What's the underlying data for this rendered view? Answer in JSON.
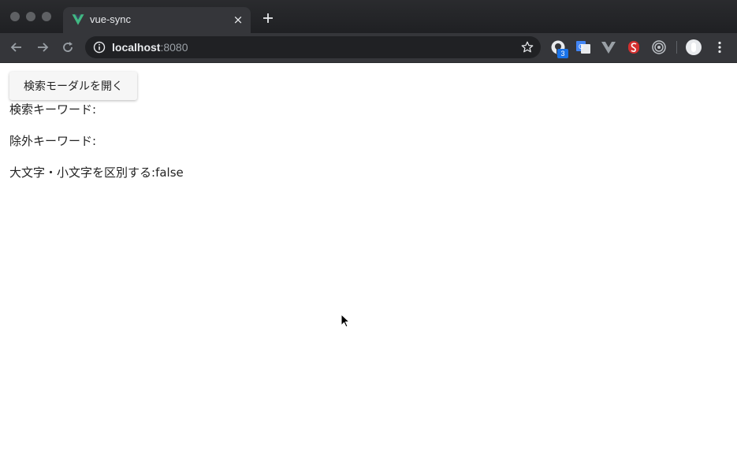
{
  "browser": {
    "tab_title": "vue-sync",
    "tab_close": "×",
    "url_host": "localhost",
    "url_port": ":8080",
    "extension_badge": "3",
    "accent_color": "#41b883"
  },
  "page": {
    "open_modal_button": "検索モーダルを開く",
    "search_keyword_label": "検索キーワード:",
    "search_keyword_value": "",
    "exclude_keyword_label": "除外キーワード:",
    "exclude_keyword_value": "",
    "case_sensitive_label": "大文字・小文字を区別する:",
    "case_sensitive_value": "false"
  },
  "icons": {
    "favicon": "vue-logo-icon",
    "back": "arrow-left-icon",
    "forward": "arrow-right-icon",
    "reload": "reload-icon",
    "info": "info-icon",
    "bookmark": "star-icon",
    "extensions": [
      "github-icon",
      "translate-icon",
      "vue-devtools-icon",
      "svelte-icon",
      "target-icon"
    ],
    "profile": "avatar-icon",
    "menu": "kebab-menu-icon"
  }
}
